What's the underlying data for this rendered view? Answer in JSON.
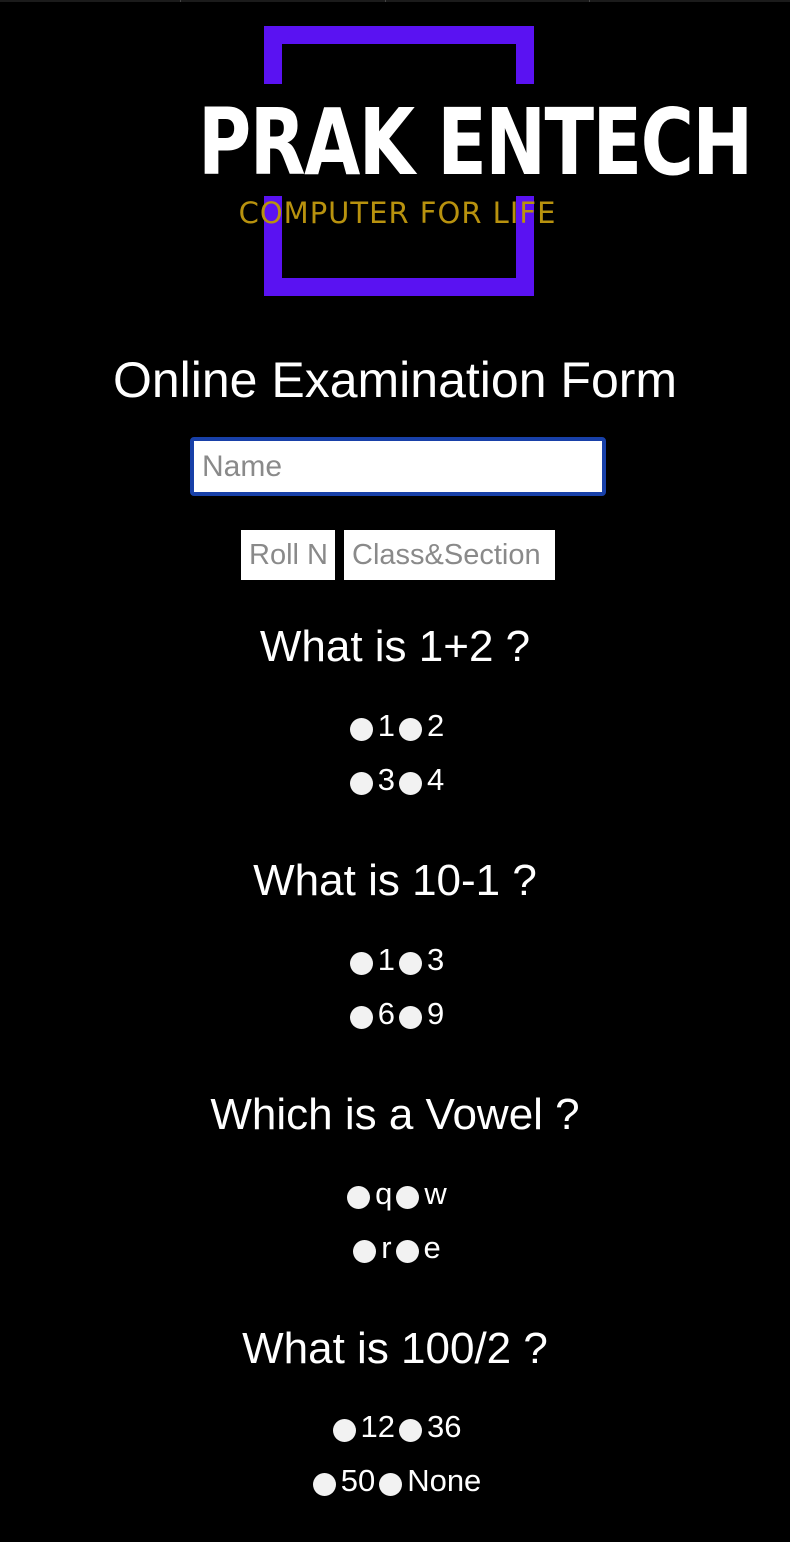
{
  "logo": {
    "title": "PRAK ENTECH",
    "tagline": "COMPUTER FOR LIFE",
    "frame_color": "#5a12f2",
    "tagline_color": "#b8920e"
  },
  "form": {
    "title": "Online Examination Form",
    "name_placeholder": "Name",
    "roll_placeholder": "Roll No",
    "class_placeholder": "Class&Section"
  },
  "questions": [
    {
      "title": "What is 1+2 ?",
      "options": [
        "1",
        "2",
        "3",
        "4"
      ]
    },
    {
      "title": "What is 10-1 ?",
      "options": [
        "1",
        "3",
        "6",
        "9"
      ]
    },
    {
      "title": "Which is a Vowel ?",
      "options": [
        "q",
        "w",
        "r",
        "e"
      ]
    },
    {
      "title": "What is 100/2 ?",
      "options": [
        "12",
        "36",
        "50",
        "None"
      ]
    }
  ]
}
